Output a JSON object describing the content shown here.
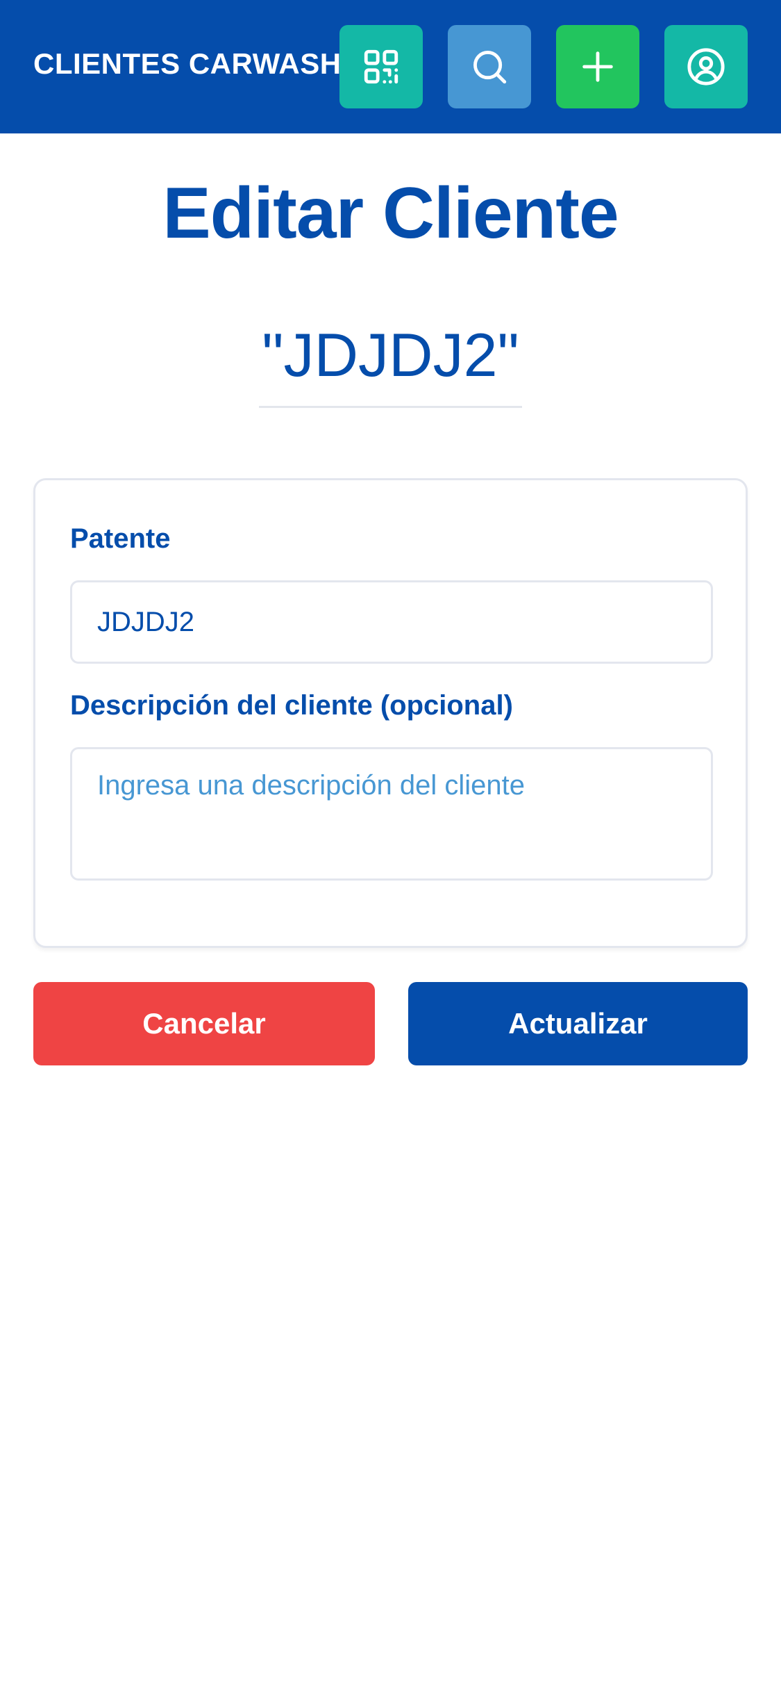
{
  "header": {
    "app_title": "CLIENTES CARWASH",
    "buttons": [
      {
        "name": "qr-code",
        "icon": "qr-code-icon",
        "color": "#14b8a6"
      },
      {
        "name": "search",
        "icon": "search-icon",
        "color": "#4797d3"
      },
      {
        "name": "add",
        "icon": "plus-icon",
        "color": "#22c55e"
      },
      {
        "name": "profile",
        "icon": "user-circle-icon",
        "color": "#14b8a6"
      }
    ],
    "background_color": "#054dab"
  },
  "page": {
    "title": "Editar Cliente",
    "plate_display": "\"JDJDJ2\""
  },
  "form": {
    "patente_label": "Patente",
    "patente_value": "JDJDJ2",
    "description_label": "Descripción del cliente (opcional)",
    "description_value": "",
    "description_placeholder": "Ingresa una descripción del cliente"
  },
  "actions": {
    "cancel_label": "Cancelar",
    "cancel_color": "#ef4444",
    "update_label": "Actualizar",
    "update_color": "#054dab"
  }
}
